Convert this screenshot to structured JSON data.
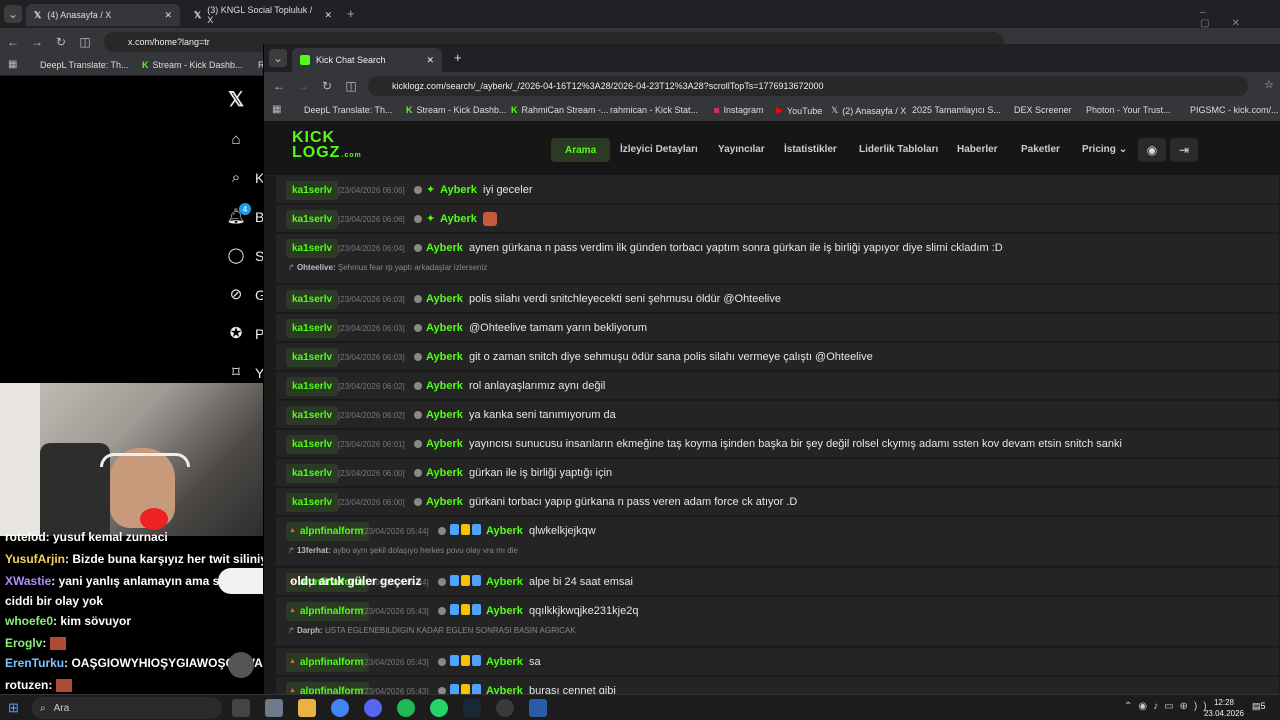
{
  "bg_browser": {
    "tabs": [
      {
        "title": "(4) Anasayfa / X",
        "active": true
      },
      {
        "title": "(3) KNGL Social Topluluk / X",
        "active": false
      }
    ],
    "url": "x.com/home?lang=tr",
    "bookmarks": [
      "DeepL Translate: Th...",
      "Stream - Kick Dashb...",
      "R"
    ]
  },
  "x_sidebar": {
    "logo": "𝕏",
    "letters": [
      "A",
      "K",
      "B",
      "S",
      "G",
      "P",
      "Y"
    ],
    "notif_count": "4"
  },
  "front_browser": {
    "tab_title": "Kick Chat Search",
    "url": "kicklogz.com/search/_/ayberk/_/2026-04-16T12%3A28/2026-04-23T12%3A28?scrollTopTs=1776913672000",
    "bookmarks": [
      "DeepL Translate: Th...",
      "Stream - Kick Dashb...",
      "RahmiCan Stream -...",
      "rahmican - Kick Stat...",
      "Instagram",
      "YouTube",
      "(2) Anasayfa / X",
      "2025 Tamamlayıcı S...",
      "DEX Screener",
      "Photon - Your Trust...",
      "PIGSMC - kick.com/..."
    ]
  },
  "site": {
    "logo_line1": "KICK",
    "logo_line2": "LOGZ",
    "logo_sub": ".com",
    "nav": [
      "Arama",
      "İzleyici Detayları",
      "Yayıncılar",
      "İstatistikler",
      "Liderlik Tabloları",
      "Haberler",
      "Paketler",
      "Pricing"
    ],
    "accent": "#53fc18"
  },
  "chat_rows": [
    {
      "user": "ka1serlv",
      "time": "[23/04/2026 06:06]",
      "channel": "Ayberk",
      "msg": "iyi geceler",
      "badge": true
    },
    {
      "user": "ka1serlv",
      "time": "[23/04/2026 06:06]",
      "channel": "Ayberk",
      "msg": "",
      "emote": true,
      "badge": true
    },
    {
      "user": "ka1serlv",
      "time": "[23/04/2026 06:04]",
      "channel": "Ayberk",
      "msg": "aynen gürkana n pass verdim ilk günden torbacı yaptım sonra gürkan ile iş birliği yapıyor diye slimi ckladım :D",
      "reply_user": "Ohteelive:",
      "reply": "Şehmus fear rp yaptı arkadaşlar izlerseniz"
    },
    {
      "user": "ka1serlv",
      "time": "[23/04/2026 06:03]",
      "channel": "Ayberk",
      "msg": "polis silahı verdi snitchleyecekti seni şehmusu öldür @Ohteelive"
    },
    {
      "user": "ka1serlv",
      "time": "[23/04/2026 06:03]",
      "channel": "Ayberk",
      "msg": "@Ohteelive tamam yarın bekliyorum"
    },
    {
      "user": "ka1serlv",
      "time": "[23/04/2026 06:03]",
      "channel": "Ayberk",
      "msg": "git o zaman snitch diye sehmuşu ödür sana polis silahı vermeye çalıştı @Ohteelive"
    },
    {
      "user": "ka1serlv",
      "time": "[23/04/2026 06:02]",
      "channel": "Ayberk",
      "msg": "rol anlayaşlarımız aynı değil"
    },
    {
      "user": "ka1serlv",
      "time": "[23/04/2026 06:02]",
      "channel": "Ayberk",
      "msg": "ya kanka seni tanımıyorum da"
    },
    {
      "user": "ka1serlv",
      "time": "[23/04/2026 06:01]",
      "channel": "Ayberk",
      "msg": "yayıncısı sunucusu insanların ekmeğine taş koyma işinden başka bir şey değil rolsel ckymış adamı ssten kov devam etsin snitch sanki"
    },
    {
      "user": "ka1serlv",
      "time": "[23/04/2026 06:00]",
      "channel": "Ayberk",
      "msg": "gürkan ile iş birliği yaptığı için"
    },
    {
      "user": "ka1serlv",
      "time": "[23/04/2026 06:00]",
      "channel": "Ayberk",
      "msg": "gürkani torbacı yapıp gürkana n pass veren adam force ck atıyor .D"
    },
    {
      "user": "alpnfinalform",
      "time": "[23/04/2026 05:44]",
      "channel": "Ayberk",
      "msg": "qlwkelkjejkqw",
      "badges3": true,
      "reply_user": "13ferhat:",
      "reply": "aybo aynı şekil dolaşıyo herkes povu olay vra mı die"
    },
    {
      "user": "alpnfinalform",
      "time": "[23/04/2026 05:44]",
      "channel": "Ayberk",
      "msg": "alpe bi 24 saat emsai",
      "badges3": true
    },
    {
      "user": "alpnfinalform",
      "time": "[23/04/2026 05:43]",
      "channel": "Ayberk",
      "msg": "qqılkkjkwqjke231kje2q",
      "badges3": true,
      "reply_user": "Darph:",
      "reply": "USTA EGLENEBILDIGIN KADAR EGLEN SONRASI BASIN AGRICAK"
    },
    {
      "user": "alpnfinalform",
      "time": "[23/04/2026 05:43]",
      "channel": "Ayberk",
      "msg": "sa",
      "badges3": true
    },
    {
      "user": "alpnfinalform",
      "time": "[23/04/2026 05:43]",
      "channel": "Ayberk",
      "msg": "burası cennet gibi",
      "badges3": true
    }
  ],
  "stream_chat": [
    {
      "user": "rotelod",
      "color": "#fff",
      "msg": ": yusuf kemal zurnaci"
    },
    {
      "user": "YusufArjin",
      "color": "#f4d35e",
      "msg": ": Bizde buna karşıyız her twit siliniyor"
    },
    {
      "user": "XWastie",
      "color": "#b18cff",
      "msg": ": yani yanlış anlamayın ama silim mi abi işi"
    },
    {
      "user": "",
      "color": "#fff",
      "msg": "ciddi bir olay yok"
    },
    {
      "user": "whoefe0",
      "color": "#8ef07a",
      "msg": ": kim sövuyor"
    },
    {
      "user": "Eroglv",
      "color": "#8ef07a",
      "msg": ":"
    },
    {
      "user": "ErenTurku",
      "color": "#7fc4ff",
      "msg": ": OAŞGIOWYHIOŞYGIAWOŞGHWAIOŞGAWIGOYWAIGO"
    },
    {
      "user": "rotuzen",
      "color": "#fff",
      "msg": ":"
    }
  ],
  "overlay_text": "oldu artık güler geçeriz",
  "taskbar": {
    "search": "Ara",
    "time": "12:28",
    "date": "23.04.2026",
    "notif": "5"
  }
}
